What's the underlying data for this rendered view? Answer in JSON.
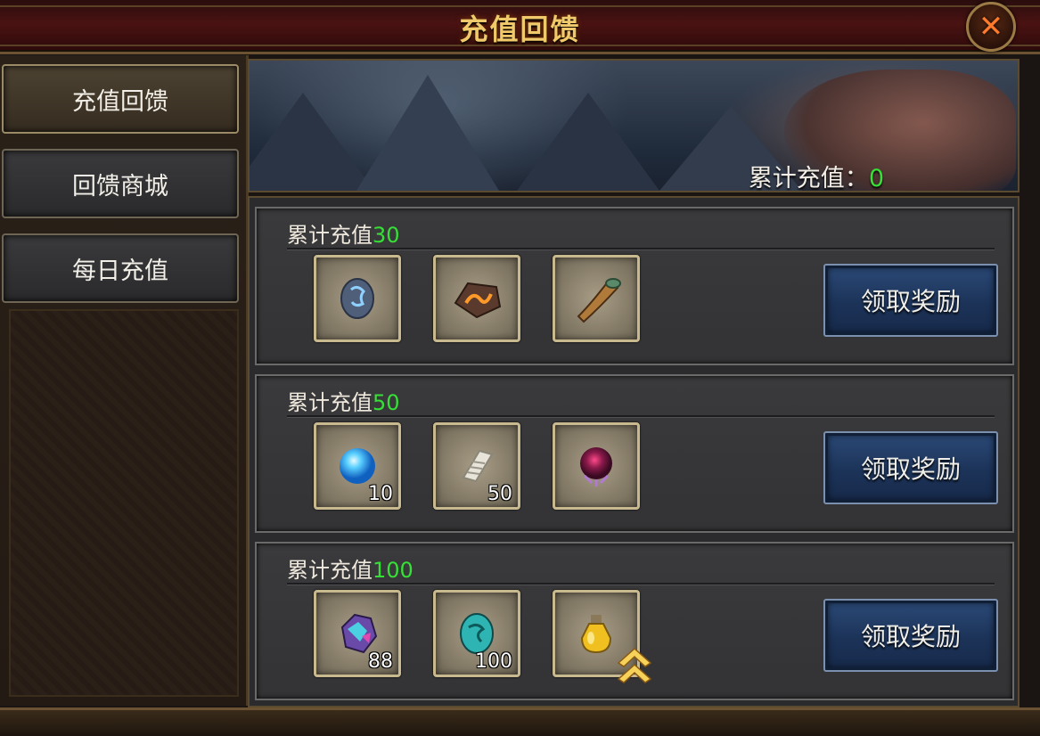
{
  "window": {
    "title": "充值回馈",
    "close_label": "close"
  },
  "sidebar": {
    "tabs": [
      {
        "label": "充值回馈",
        "active": true
      },
      {
        "label": "回馈商城",
        "active": false
      },
      {
        "label": "每日充值",
        "active": false
      }
    ]
  },
  "banner": {
    "total_label": "累计充值：",
    "total_value": "0"
  },
  "rewards": [
    {
      "label": "累计充值",
      "amount": "30",
      "button": "领取奖励",
      "items": [
        {
          "icon": "rune-stone-icon",
          "count": ""
        },
        {
          "icon": "fire-ore-icon",
          "count": ""
        },
        {
          "icon": "horn-icon",
          "count": ""
        }
      ]
    },
    {
      "label": "累计充值",
      "amount": "50",
      "button": "领取奖励",
      "items": [
        {
          "icon": "blue-orb-icon",
          "count": "10"
        },
        {
          "icon": "scroll-icon",
          "count": "50"
        },
        {
          "icon": "purple-orb-icon",
          "count": ""
        }
      ]
    },
    {
      "label": "累计充值",
      "amount": "100",
      "button": "领取奖励",
      "items": [
        {
          "icon": "crystal-ore-icon",
          "count": "88"
        },
        {
          "icon": "jade-stone-icon",
          "count": "100"
        },
        {
          "icon": "potion-bottle-icon",
          "count": ""
        }
      ]
    }
  ],
  "colors": {
    "accent_green": "#37e037",
    "title_gold": "#f0c96a",
    "button_blue": "#1c3358"
  }
}
